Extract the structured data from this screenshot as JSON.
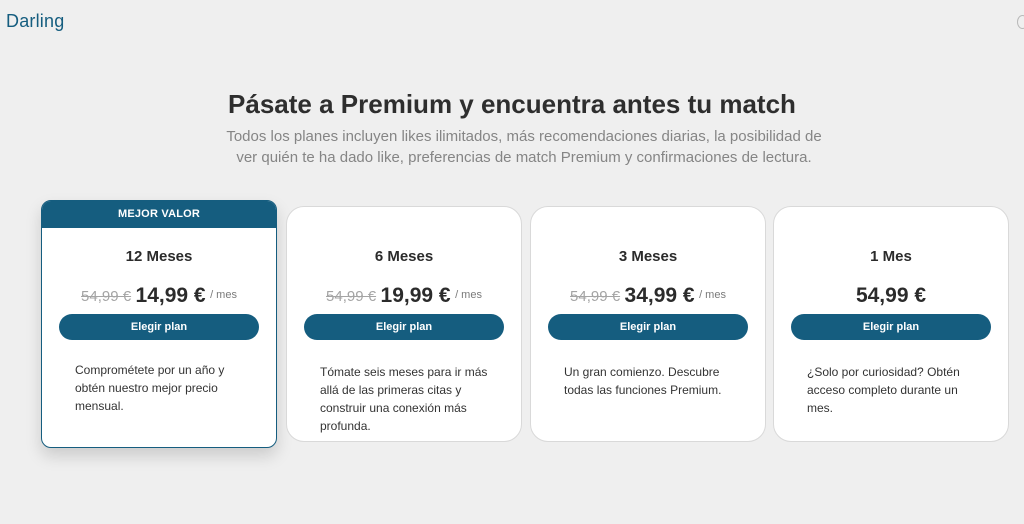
{
  "brand": {
    "logo_text": "Darling"
  },
  "hero": {
    "title": "Pásate a Premium y encuentra antes tu match",
    "subtitle": "Todos los planes incluyen likes ilimitados, más recomendaciones diarias, la posibilidad de ver quién te ha dado like, preferencias de match Premium y confirmaciones de lectura."
  },
  "plans": [
    {
      "badge": "MEJOR VALOR",
      "title": "12 Meses",
      "old_price": "54,99 €",
      "price": "14,99 €",
      "per": "/ mes",
      "button": "Elegir plan",
      "description": "Comprométete por un año y obtén nuestro mejor precio mensual."
    },
    {
      "title": "6 Meses",
      "old_price": "54,99 €",
      "price": "19,99 €",
      "per": "/ mes",
      "button": "Elegir plan",
      "description": "Tómate seis meses para ir más allá de las primeras citas y construir una conexión más profunda."
    },
    {
      "title": "3 Meses",
      "old_price": "54,99 €",
      "price": "34,99 €",
      "per": "/ mes",
      "button": "Elegir plan",
      "description": "Un gran comienzo. Descubre todas las funciones Premium."
    },
    {
      "title": "1 Mes",
      "price": "54,99 €",
      "button": "Elegir plan",
      "description": "¿Solo por curiosidad? Obtén acceso completo durante un mes."
    }
  ],
  "colors": {
    "accent": "#155d7f",
    "background": "#efefef"
  }
}
